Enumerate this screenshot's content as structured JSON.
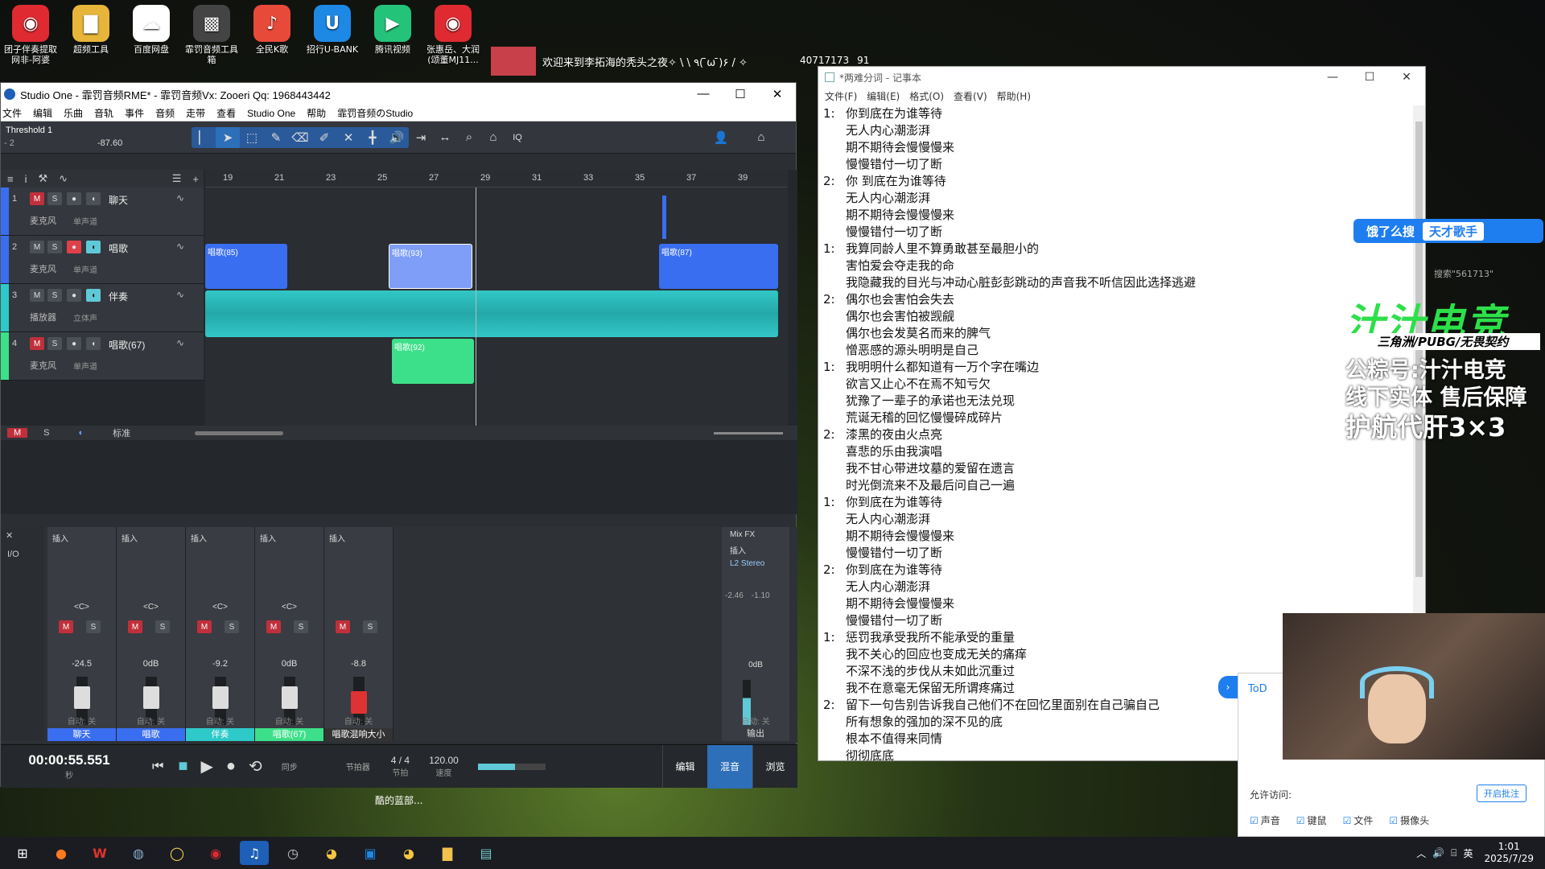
{
  "desktop_icons": [
    {
      "label": "团子伴奏提取\n网非-阿婆",
      "color": "#e02a32",
      "glyph": "◉"
    },
    {
      "label": "超频工具",
      "color": "#e7b53a",
      "glyph": "▇"
    },
    {
      "label": "百度网盘",
      "color": "#fff",
      "glyph": "☁"
    },
    {
      "label": "霏罚音频工具箱",
      "color": "#444",
      "glyph": "▩"
    },
    {
      "label": "全民K歌",
      "color": "#e84a3a",
      "glyph": "♪"
    },
    {
      "label": "招行U-BANK",
      "color": "#1e88e5",
      "glyph": "U"
    },
    {
      "label": "腾讯视频",
      "color": "#24c37a",
      "glyph": "▶"
    },
    {
      "label": "张惠岳、大润\n(颂董MJ11...",
      "color": "#e02a32",
      "glyph": "◉"
    }
  ],
  "topstrip": {
    "text": "欢迎来到李拓海的秃头之夜✧ \\ \\ ٩( ̄ω ̄)۶ / ✧",
    "count": "40717173",
    "likes": "91"
  },
  "studio_one": {
    "title": "Studio One - 霏罚音频RME* - 霏罚音频Vx: Zooeri Qq: 1968443442",
    "menu": [
      "文件",
      "编辑",
      "乐曲",
      "音轨",
      "事件",
      "音频",
      "走带",
      "查看",
      "Studio One",
      "帮助",
      "霏罚音频のStudio"
    ],
    "threshold": {
      "label": "Threshold 1",
      "value": "-87.60",
      "left": "- 2"
    },
    "ruler": [
      "19",
      "21",
      "23",
      "25",
      "27",
      "29",
      "31",
      "33",
      "35",
      "37",
      "39"
    ],
    "tracks": [
      {
        "num": "1",
        "name": "聊天",
        "sub": "麦克风",
        "mode": "单声道",
        "color": "#3a6ef0",
        "m_on": true,
        "r_on": false,
        "mon_on": false
      },
      {
        "num": "2",
        "name": "唱歌",
        "sub": "麦克风",
        "mode": "单声道",
        "color": "#3a6ef0",
        "m_on": false,
        "r_on": true,
        "mon_on": true
      },
      {
        "num": "3",
        "name": "伴奏",
        "sub": "播放器",
        "mode": "立体声",
        "color": "#2ec9c9",
        "m_on": false,
        "r_on": false,
        "mon_on": true
      },
      {
        "num": "4",
        "name": "唱歌(67)",
        "sub": "麦克风",
        "mode": "单声道",
        "color": "#3de08a",
        "m_on": true,
        "r_on": false,
        "mon_on": false
      }
    ],
    "clips": [
      "唱歌(85)",
      "唱歌(93)",
      "唱歌(87)",
      "唱歌(92)"
    ],
    "bottom_bar": {
      "m": "M",
      "s": "S",
      "mode": "标准"
    },
    "mixer": {
      "insert": "插入",
      "io": "I/O",
      "channels": [
        {
          "name": "聊天",
          "level": "-24.5",
          "pan": "<C>",
          "num": "1",
          "auto": "自动: 关",
          "color": "#3a6ef0"
        },
        {
          "name": "唱歌",
          "level": "0dB",
          "pan": "<C>",
          "num": "2",
          "auto": "自动: 关",
          "color": "#3a6ef0"
        },
        {
          "name": "伴奏",
          "level": "-9.2",
          "pan": "<C>",
          "num": "3",
          "auto": "自动: 关",
          "color": "#2ec9c9"
        },
        {
          "name": "唱歌(67)",
          "level": "0dB",
          "pan": "<C>",
          "num": "4",
          "auto": "自动: 关",
          "color": "#3de08a"
        },
        {
          "name": "唱歌混响大小",
          "level": "-8.8",
          "pan": "",
          "num": "",
          "auto": "自动: 关",
          "color": "#333"
        }
      ],
      "mixfx": "Mix FX",
      "l2": "L2 Stereo",
      "out_vals": [
        "-2.46",
        "-1.10"
      ],
      "out_level": "0dB",
      "out_name": "输出",
      "out_auto": "自动: 关"
    },
    "transport": {
      "time": "00:00:55.551",
      "time_unit": "秒",
      "sync": "同步",
      "meter": "4 / 4",
      "meter_label": "节拍",
      "tempo": "120.00",
      "tempo_label": "速度",
      "metronome": "节拍器",
      "tabs": [
        "编辑",
        "混音",
        "浏览"
      ]
    }
  },
  "notepad": {
    "title": "*两难分词 - 记事本",
    "menu": [
      "文件(F)",
      "编辑(E)",
      "格式(O)",
      "查看(V)",
      "帮助(H)"
    ],
    "lines": [
      {
        "n": "1:",
        "t": "你到底在为谁等待"
      },
      {
        "n": "",
        "t": "无人内心潮澎湃"
      },
      {
        "n": "",
        "t": "期不期待会慢慢慢来"
      },
      {
        "n": "",
        "t": "慢慢错付一切了断"
      },
      {
        "n": "2:",
        "t": "你  到底在为谁等待"
      },
      {
        "n": "",
        "t": "无人内心潮澎湃"
      },
      {
        "n": "",
        "t": "期不期待会慢慢慢来"
      },
      {
        "n": "",
        "t": "慢慢错付一切了断"
      },
      {
        "n": "1:",
        "t": "我算同龄人里不算勇敢甚至最胆小的"
      },
      {
        "n": "",
        "t": "害怕爱会夺走我的命"
      },
      {
        "n": "",
        "t": "我隐藏我的目光与冲动心脏彭彭跳动的声音我不听信因此选择逃避"
      },
      {
        "n": "2:",
        "t": "偶尔也会害怕会失去"
      },
      {
        "n": "",
        "t": "偶尔也会害怕被觊觎"
      },
      {
        "n": "",
        "t": "偶尔也会发莫名而来的脾气"
      },
      {
        "n": "",
        "t": "憎恶感的源头明明是自己"
      },
      {
        "n": "1:",
        "t": "我明明什么都知道有一万个字在嘴边"
      },
      {
        "n": "",
        "t": "欲言又止心不在焉不知亏欠"
      },
      {
        "n": "",
        "t": "犹豫了一辈子的承诺也无法兑现"
      },
      {
        "n": "",
        "t": "荒诞无稽的回忆慢慢碎成碎片"
      },
      {
        "n": "2:",
        "t": "漆黑的夜由火点亮"
      },
      {
        "n": "",
        "t": "喜悲的乐由我演唱"
      },
      {
        "n": "",
        "t": "我不甘心带进坟墓的爱留在遗言"
      },
      {
        "n": "",
        "t": "时光倒流来不及最后问自己一遍"
      },
      {
        "n": "1:",
        "t": "你到底在为谁等待"
      },
      {
        "n": "",
        "t": "无人内心潮澎湃"
      },
      {
        "n": "",
        "t": "期不期待会慢慢慢来"
      },
      {
        "n": "",
        "t": "慢慢错付一切了断"
      },
      {
        "n": "2:",
        "t": "你到底在为谁等待"
      },
      {
        "n": "",
        "t": "无人内心潮澎湃"
      },
      {
        "n": "",
        "t": "期不期待会慢慢慢来"
      },
      {
        "n": "",
        "t": "慢慢错付一切了断"
      },
      {
        "n": "1:",
        "t": "惩罚我承受我所不能承受的重量"
      },
      {
        "n": "",
        "t": "我不关心的回应也变成无关的痛痒"
      },
      {
        "n": "",
        "t": "不深不浅的步伐从未如此沉重过"
      },
      {
        "n": "",
        "t": "我不在意毫无保留无所谓疼痛过"
      },
      {
        "n": "2:",
        "t": "留下一句告别告诉我自己他们不在回忆里面别在自己骗自己"
      },
      {
        "n": "",
        "t": "所有想象的强加的深不见的底"
      },
      {
        "n": "",
        "t": "根本不值得来同情"
      },
      {
        "n": "",
        "t": "彻彻底底"
      }
    ]
  },
  "overlay": {
    "search_btn": "饿了么搜",
    "search_tag": "天才歌手",
    "search_hint": "搜索\"561713\"",
    "brand": "汁汁电竞",
    "brand_sub": "三角洲/PUBG/无畏契约",
    "line1": "公粽号:汁汁电竞",
    "line2": "线下实体 售后保障",
    "line3": "护航代肝3×3",
    "allow": "允许访问:",
    "annot_btn": "开启批注",
    "perms": [
      "声音",
      "键鼠",
      "文件",
      "摄像头"
    ],
    "todo": "ToD"
  },
  "bg_caption": "酷的蓝部...",
  "clock": {
    "time": "1:01",
    "date": "2025/7/29"
  },
  "tray_lang": "英"
}
